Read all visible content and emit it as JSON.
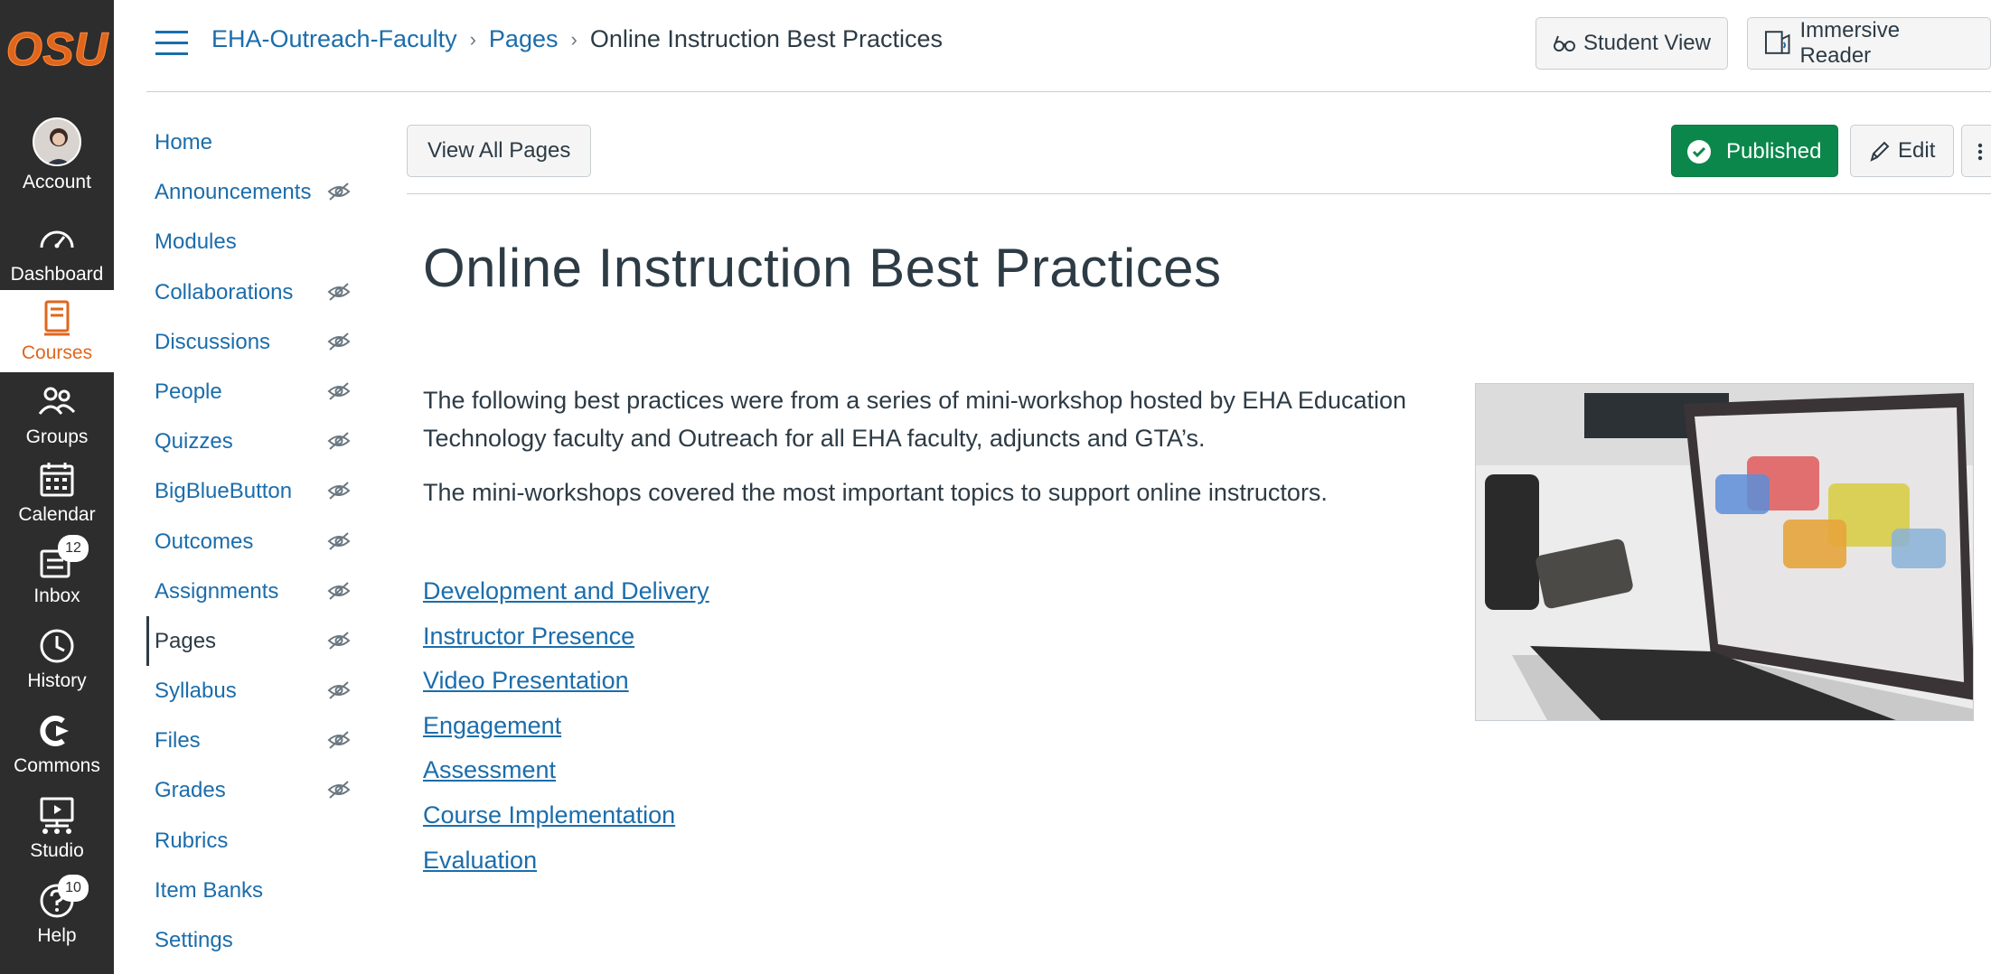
{
  "global_nav": {
    "logo_text": "OSU",
    "items": [
      {
        "label": "Account",
        "icon": "avatar"
      },
      {
        "label": "Dashboard",
        "icon": "dashboard-icon"
      },
      {
        "label": "Courses",
        "icon": "courses-icon",
        "active": true
      },
      {
        "label": "Groups",
        "icon": "groups-icon"
      },
      {
        "label": "Calendar",
        "icon": "calendar-icon"
      },
      {
        "label": "Inbox",
        "icon": "inbox-icon",
        "badge": "12"
      },
      {
        "label": "History",
        "icon": "history-icon"
      },
      {
        "label": "Commons",
        "icon": "commons-icon"
      },
      {
        "label": "Studio",
        "icon": "studio-icon"
      },
      {
        "label": "Help",
        "icon": "help-icon",
        "badge": "10"
      }
    ],
    "active_color": "#e0661d"
  },
  "header": {
    "breadcrumbs": [
      "EHA-Outreach-Faculty",
      "Pages",
      "Online Instruction Best Practices"
    ],
    "student_view_label": "Student View",
    "immersive_reader_label": "Immersive Reader"
  },
  "course_nav": [
    {
      "label": "Home",
      "hidden": false
    },
    {
      "label": "Announcements",
      "hidden": true
    },
    {
      "label": "Modules",
      "hidden": false
    },
    {
      "label": "Collaborations",
      "hidden": true
    },
    {
      "label": "Discussions",
      "hidden": true
    },
    {
      "label": "People",
      "hidden": true
    },
    {
      "label": "Quizzes",
      "hidden": true
    },
    {
      "label": "BigBlueButton",
      "hidden": true
    },
    {
      "label": "Outcomes",
      "hidden": true
    },
    {
      "label": "Assignments",
      "hidden": true
    },
    {
      "label": "Pages",
      "hidden": true,
      "active": true
    },
    {
      "label": "Syllabus",
      "hidden": true
    },
    {
      "label": "Files",
      "hidden": true
    },
    {
      "label": "Grades",
      "hidden": true
    },
    {
      "label": "Rubrics",
      "hidden": false
    },
    {
      "label": "Item Banks",
      "hidden": false
    },
    {
      "label": "Settings",
      "hidden": false
    }
  ],
  "toolbar": {
    "view_all_label": "View All Pages",
    "published_label": "Published",
    "edit_label": "Edit"
  },
  "page": {
    "title": "Online Instruction Best Practices",
    "paragraph1": "The following best practices were from a series of mini-workshop hosted by EHA Education Technology faculty and Outreach for all EHA faculty, adjuncts and GTA’s.",
    "paragraph2": "The mini-workshops covered the most important topics to support online instructors.",
    "links": [
      "Development and Delivery",
      "Instructor Presence",
      "Video Presentation",
      "Engagement",
      "Assessment",
      "Course Implementation",
      "Evaluation"
    ]
  },
  "colors": {
    "link": "#1b6dab",
    "published": "#0b874b",
    "nav_bg": "#2d2d2d"
  }
}
